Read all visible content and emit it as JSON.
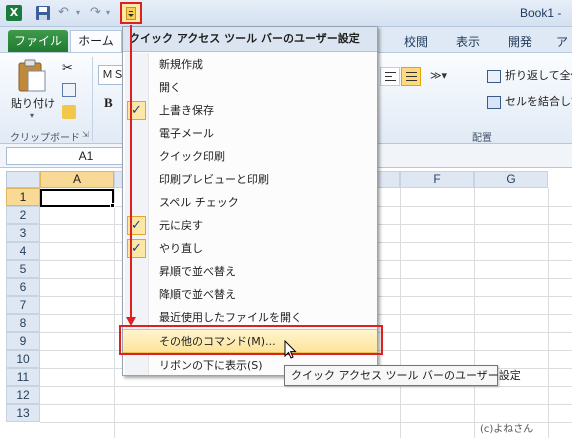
{
  "app": {
    "window_title": "Book1 -",
    "excel_icon": "excel-icon",
    "undo_glyph": "↶",
    "redo_glyph": "↷",
    "dropdown_glyph": "▾"
  },
  "ribbon": {
    "tabs": {
      "file": "ファイル",
      "home": "ホーム",
      "review": "校閲",
      "view": "表示",
      "developer": "開発",
      "more": "ア"
    },
    "clipboard": {
      "paste_label": "貼り付け",
      "group_label": "クリップボード",
      "launcher_glyph": "⇲"
    },
    "font": {
      "font_name": "ＭＳ",
      "bold": "B"
    },
    "alignment": {
      "orientation_glyph": "≫▾",
      "wrap_text": "折り返して全体",
      "merge_center": "セルを結合して",
      "group_label": "配置"
    }
  },
  "formula_bar": {
    "name_box": "A1"
  },
  "grid": {
    "columns": [
      "A",
      "",
      "",
      "",
      "",
      "F",
      "G"
    ],
    "rows": [
      "1",
      "2",
      "3",
      "4",
      "5",
      "6",
      "7",
      "8",
      "9",
      "10",
      "11",
      "12",
      "13"
    ],
    "selected_column": "A",
    "selected_row": "1"
  },
  "menu": {
    "header": "クイック アクセス ツール バーのユーザー設定",
    "check_glyph": "✓",
    "items": [
      {
        "label": "新規作成",
        "checked": false
      },
      {
        "label": "開く",
        "checked": false
      },
      {
        "label": "上書き保存",
        "checked": true
      },
      {
        "label": "電子メール",
        "checked": false
      },
      {
        "label": "クイック印刷",
        "checked": false
      },
      {
        "label": "印刷プレビューと印刷",
        "checked": false
      },
      {
        "label": "スペル チェック",
        "checked": false
      },
      {
        "label": "元に戻す",
        "checked": true
      },
      {
        "label": "やり直し",
        "checked": true
      },
      {
        "label": "昇順で並べ替え",
        "checked": false
      },
      {
        "label": "降順で並べ替え",
        "checked": false
      },
      {
        "label": "最近使用したファイルを開く",
        "checked": false
      }
    ],
    "more_commands": "その他のコマンド(M)...",
    "show_below_ribbon": "リボンの下に表示(S)"
  },
  "tooltip": "クイック アクセス ツール バーのユーザー設定",
  "watermark": "(c)よねさん",
  "colors": {
    "annotation_red": "#e02020",
    "highlight_yellow": "#fde49a",
    "file_tab_green": "#1f7a30"
  }
}
